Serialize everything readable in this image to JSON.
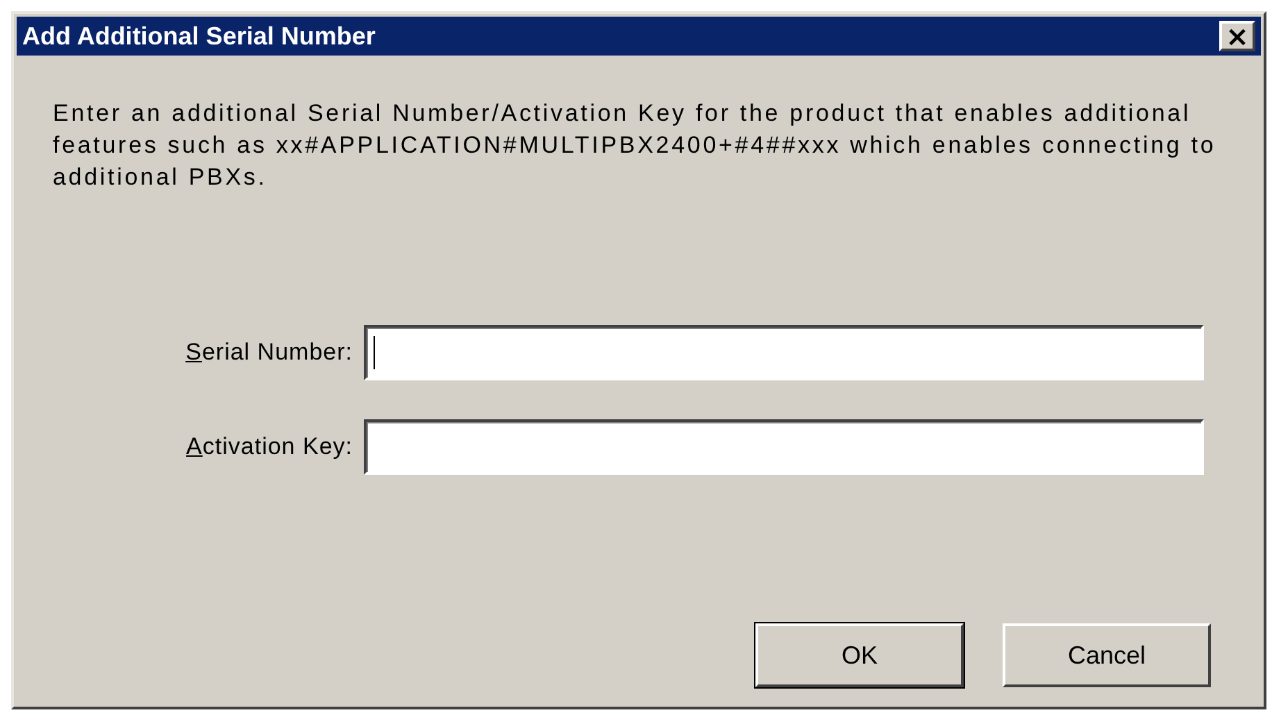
{
  "window": {
    "title": "Add Additional Serial Number",
    "close_button": "×"
  },
  "description": "Enter an additional Serial Number/Activation Key for the product that enables additional features such as xx#APPLICATION#MULTIPBX2400+#4##xxx which enables connecting to additional PBXs.",
  "fields": [
    {
      "label": "Serial Number:",
      "focused": true
    },
    {
      "label": "Activation Key:",
      "focused": false
    }
  ],
  "buttons": [
    {
      "label": "OK",
      "default": true
    },
    {
      "label": "Cancel",
      "default": false
    }
  ]
}
